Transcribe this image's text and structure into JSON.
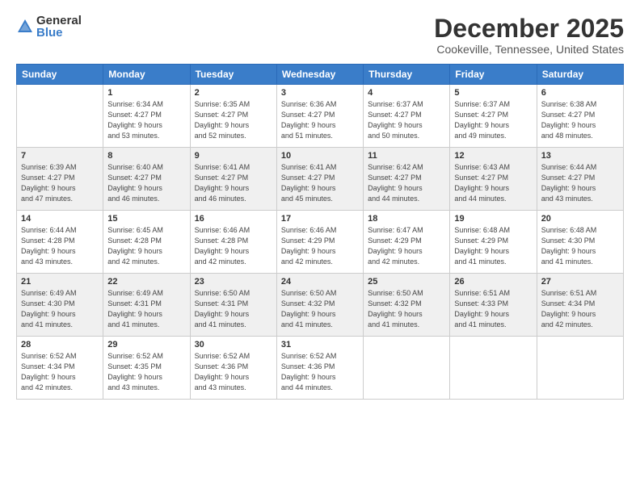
{
  "logo": {
    "general": "General",
    "blue": "Blue"
  },
  "title": "December 2025",
  "subtitle": "Cookeville, Tennessee, United States",
  "header_days": [
    "Sunday",
    "Monday",
    "Tuesday",
    "Wednesday",
    "Thursday",
    "Friday",
    "Saturday"
  ],
  "weeks": [
    [
      {
        "day": "",
        "info": ""
      },
      {
        "day": "1",
        "info": "Sunrise: 6:34 AM\nSunset: 4:27 PM\nDaylight: 9 hours\nand 53 minutes."
      },
      {
        "day": "2",
        "info": "Sunrise: 6:35 AM\nSunset: 4:27 PM\nDaylight: 9 hours\nand 52 minutes."
      },
      {
        "day": "3",
        "info": "Sunrise: 6:36 AM\nSunset: 4:27 PM\nDaylight: 9 hours\nand 51 minutes."
      },
      {
        "day": "4",
        "info": "Sunrise: 6:37 AM\nSunset: 4:27 PM\nDaylight: 9 hours\nand 50 minutes."
      },
      {
        "day": "5",
        "info": "Sunrise: 6:37 AM\nSunset: 4:27 PM\nDaylight: 9 hours\nand 49 minutes."
      },
      {
        "day": "6",
        "info": "Sunrise: 6:38 AM\nSunset: 4:27 PM\nDaylight: 9 hours\nand 48 minutes."
      }
    ],
    [
      {
        "day": "7",
        "info": "Sunrise: 6:39 AM\nSunset: 4:27 PM\nDaylight: 9 hours\nand 47 minutes."
      },
      {
        "day": "8",
        "info": "Sunrise: 6:40 AM\nSunset: 4:27 PM\nDaylight: 9 hours\nand 46 minutes."
      },
      {
        "day": "9",
        "info": "Sunrise: 6:41 AM\nSunset: 4:27 PM\nDaylight: 9 hours\nand 46 minutes."
      },
      {
        "day": "10",
        "info": "Sunrise: 6:41 AM\nSunset: 4:27 PM\nDaylight: 9 hours\nand 45 minutes."
      },
      {
        "day": "11",
        "info": "Sunrise: 6:42 AM\nSunset: 4:27 PM\nDaylight: 9 hours\nand 44 minutes."
      },
      {
        "day": "12",
        "info": "Sunrise: 6:43 AM\nSunset: 4:27 PM\nDaylight: 9 hours\nand 44 minutes."
      },
      {
        "day": "13",
        "info": "Sunrise: 6:44 AM\nSunset: 4:27 PM\nDaylight: 9 hours\nand 43 minutes."
      }
    ],
    [
      {
        "day": "14",
        "info": "Sunrise: 6:44 AM\nSunset: 4:28 PM\nDaylight: 9 hours\nand 43 minutes."
      },
      {
        "day": "15",
        "info": "Sunrise: 6:45 AM\nSunset: 4:28 PM\nDaylight: 9 hours\nand 42 minutes."
      },
      {
        "day": "16",
        "info": "Sunrise: 6:46 AM\nSunset: 4:28 PM\nDaylight: 9 hours\nand 42 minutes."
      },
      {
        "day": "17",
        "info": "Sunrise: 6:46 AM\nSunset: 4:29 PM\nDaylight: 9 hours\nand 42 minutes."
      },
      {
        "day": "18",
        "info": "Sunrise: 6:47 AM\nSunset: 4:29 PM\nDaylight: 9 hours\nand 42 minutes."
      },
      {
        "day": "19",
        "info": "Sunrise: 6:48 AM\nSunset: 4:29 PM\nDaylight: 9 hours\nand 41 minutes."
      },
      {
        "day": "20",
        "info": "Sunrise: 6:48 AM\nSunset: 4:30 PM\nDaylight: 9 hours\nand 41 minutes."
      }
    ],
    [
      {
        "day": "21",
        "info": "Sunrise: 6:49 AM\nSunset: 4:30 PM\nDaylight: 9 hours\nand 41 minutes."
      },
      {
        "day": "22",
        "info": "Sunrise: 6:49 AM\nSunset: 4:31 PM\nDaylight: 9 hours\nand 41 minutes."
      },
      {
        "day": "23",
        "info": "Sunrise: 6:50 AM\nSunset: 4:31 PM\nDaylight: 9 hours\nand 41 minutes."
      },
      {
        "day": "24",
        "info": "Sunrise: 6:50 AM\nSunset: 4:32 PM\nDaylight: 9 hours\nand 41 minutes."
      },
      {
        "day": "25",
        "info": "Sunrise: 6:50 AM\nSunset: 4:32 PM\nDaylight: 9 hours\nand 41 minutes."
      },
      {
        "day": "26",
        "info": "Sunrise: 6:51 AM\nSunset: 4:33 PM\nDaylight: 9 hours\nand 41 minutes."
      },
      {
        "day": "27",
        "info": "Sunrise: 6:51 AM\nSunset: 4:34 PM\nDaylight: 9 hours\nand 42 minutes."
      }
    ],
    [
      {
        "day": "28",
        "info": "Sunrise: 6:52 AM\nSunset: 4:34 PM\nDaylight: 9 hours\nand 42 minutes."
      },
      {
        "day": "29",
        "info": "Sunrise: 6:52 AM\nSunset: 4:35 PM\nDaylight: 9 hours\nand 43 minutes."
      },
      {
        "day": "30",
        "info": "Sunrise: 6:52 AM\nSunset: 4:36 PM\nDaylight: 9 hours\nand 43 minutes."
      },
      {
        "day": "31",
        "info": "Sunrise: 6:52 AM\nSunset: 4:36 PM\nDaylight: 9 hours\nand 44 minutes."
      },
      {
        "day": "",
        "info": ""
      },
      {
        "day": "",
        "info": ""
      },
      {
        "day": "",
        "info": ""
      }
    ]
  ]
}
